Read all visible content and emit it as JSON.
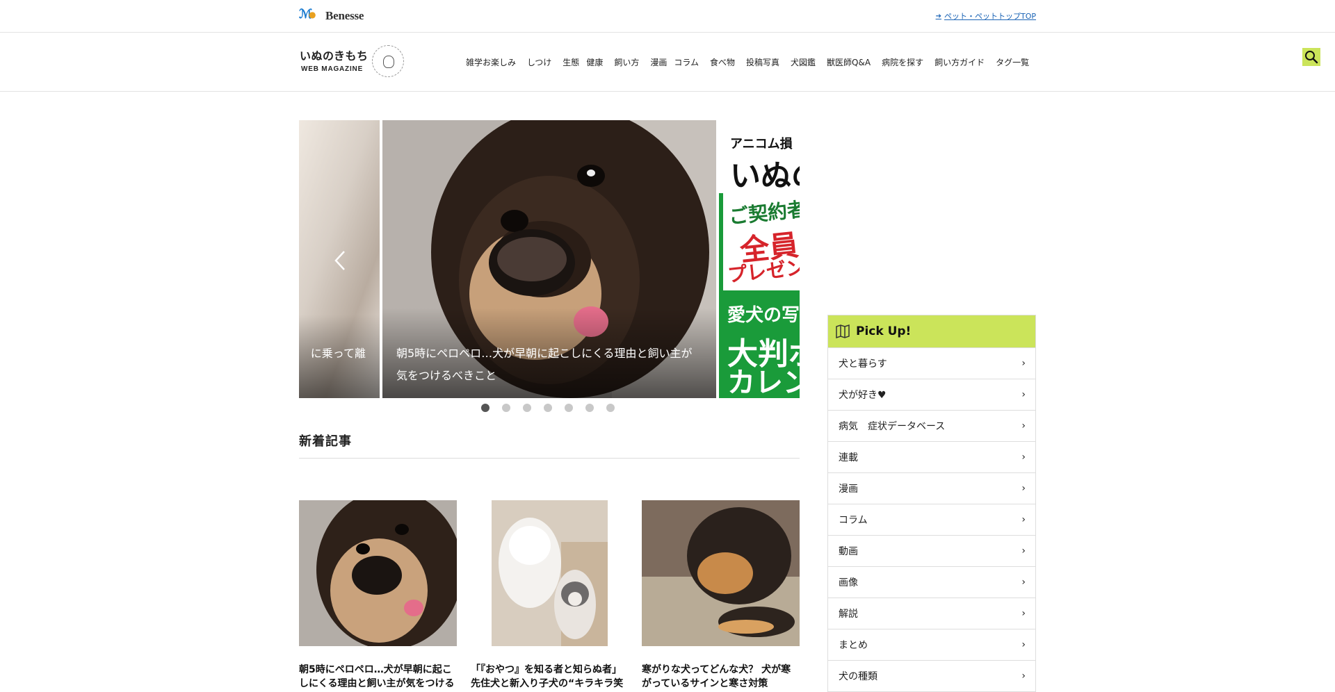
{
  "topbar": {
    "brand": "Benesse",
    "top_link": "ペット・ペットトップTOP"
  },
  "header": {
    "logo_jp": "いぬのきもち",
    "logo_en": "WEB MAGAZINE",
    "nav": [
      "雑学お楽しみ",
      "しつけ",
      "生態",
      "健康",
      "飼い方",
      "漫画",
      "コラム",
      "食べ物",
      "投稿写真",
      "犬図鑑",
      "獣医師Q&A",
      "病院を探す",
      "飼い方ガイド",
      "タグ一覧"
    ]
  },
  "slider": {
    "left_caption": "に乗って離",
    "main_caption": "朝5時にペロペロ…犬が早朝に起こしにくる理由と飼い主が気をつけるべきこと",
    "ad": {
      "line1": "アニコム損",
      "line2": "いぬの",
      "white1": "ご契約者",
      "white2": "全員",
      "white3": "プレゼン",
      "green1": "愛犬の写",
      "green2": "大判ポ",
      "green3": "カレン"
    },
    "dots_count": 7,
    "active_dot": 1
  },
  "section": {
    "title": "新着記事"
  },
  "cards": [
    {
      "title": "朝5時にペロペロ…犬が早朝に起こしにくる理由と飼い主が気をつける"
    },
    {
      "title": "「『おやつ』を知る者と知らぬ者」先住犬と新入り子犬の“キラキラ笑"
    },
    {
      "title": "寒がりな犬ってどんな犬？ 犬が寒がっているサインと寒さ対策"
    }
  ],
  "pickup": {
    "title": "Pick Up!",
    "items": [
      "犬と暮らす",
      "犬が好き♥",
      "病気　症状データベース",
      "連載",
      "漫画",
      "コラム",
      "動画",
      "画像",
      "解説",
      "まとめ",
      "犬の種類"
    ]
  },
  "colors": {
    "accent": "#cbe45a",
    "link": "#1a63b5"
  }
}
